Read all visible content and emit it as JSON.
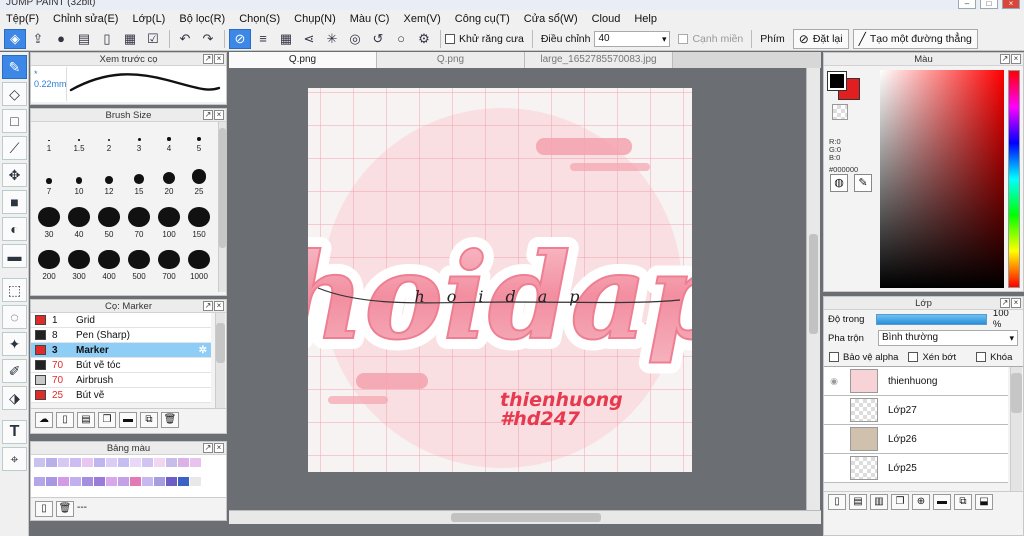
{
  "window": {
    "title": "JUMP PAINT (32bit)"
  },
  "menu": [
    "Tệp(F)",
    "Chỉnh sửa(E)",
    "Lớp(L)",
    "Bộ lọc(R)",
    "Chọn(S)",
    "Chụp(N)",
    "Màu (C)",
    "Xem(V)",
    "Công cụ(T)",
    "Cửa sổ(W)",
    "Cloud",
    "Help"
  ],
  "toolbar": {
    "antialias_label": "Khử răng cưa",
    "adjust_label": "Điều chỉnh",
    "adjust_value": "40",
    "edge_label": "Cạnh miền",
    "key_label": "Phím",
    "reset_label": "Đặt lại",
    "line_label": "Tạo một đường thẳng"
  },
  "brush_preview": {
    "title": "Xem trước cọ",
    "size": "0.22mm"
  },
  "brush_size": {
    "title": "Brush Size",
    "sizes": [
      "1",
      "1.5",
      "2",
      "3",
      "4",
      "5",
      "7",
      "10",
      "12",
      "15",
      "20",
      "25",
      "30",
      "40",
      "50",
      "70",
      "100",
      "150",
      "200",
      "300",
      "400",
      "500",
      "700",
      "1000"
    ]
  },
  "brush_list": {
    "title": "Cọ: Marker",
    "items": [
      {
        "size": "1",
        "name": "Grid",
        "color": "#e02b2b"
      },
      {
        "size": "8",
        "name": "Pen (Sharp)",
        "color": "#222222"
      },
      {
        "size": "3",
        "name": "Marker",
        "color": "#e02b2b",
        "selected": true
      },
      {
        "size": "70",
        "name": "Bút vẽ tóc",
        "color": "#222222"
      },
      {
        "size": "70",
        "name": "Airbrush",
        "color": "#c8c8c8"
      },
      {
        "size": "25",
        "name": "Bút vẽ",
        "color": "#e02b2b"
      }
    ]
  },
  "palette": {
    "title": "Bảng màu",
    "footer": "---",
    "colors": [
      "#c9c2f0",
      "#b9b0ea",
      "#d7c7f2",
      "#cbbdf1",
      "#e8c6f0",
      "#bfb5ef",
      "#d9cdf5",
      "#c6bdf0",
      "#e8d8f7",
      "#d2c3f3",
      "#f1d6ef",
      "#c8bce9",
      "#dcb2e6",
      "#e7c3ee",
      "#b4a6e8",
      "#a897e3",
      "#d39ae6",
      "#c1b0ee",
      "#a48ee0",
      "#9b7bd9",
      "#d8a8ea",
      "#c6a0e6",
      "#e27ab6",
      "#c9b7ef",
      "#a69ce0",
      "#6c5ec4",
      "#3c62c7",
      "#e8e8e8"
    ]
  },
  "tabs": [
    {
      "label": "Q.png",
      "active": true
    },
    {
      "label": "Q.png",
      "active": false
    },
    {
      "label": "large_1652785570083.jpg",
      "active": false
    }
  ],
  "canvas": {
    "art_word": "hoidap",
    "script_word": "hoidap",
    "sig_line1": "thienhuong",
    "sig_line2": "#hd247"
  },
  "color_panel": {
    "title": "Màu",
    "r": "R:0",
    "g": "G:0",
    "b": "B:0",
    "hex": "#000000",
    "fg": "#000000",
    "bg": "#e02020"
  },
  "layer_panel": {
    "title": "Lớp",
    "opacity_label": "Độ trong",
    "opacity_value": "100 %",
    "blend_label": "Pha trộn",
    "blend_value": "Bình thường",
    "protect_alpha": "Bảo vệ alpha",
    "clip": "Xén bớt",
    "lock": "Khóa",
    "layers": [
      "thienhuong",
      "Lớp27",
      "Lớp26",
      "Lớp25"
    ]
  }
}
